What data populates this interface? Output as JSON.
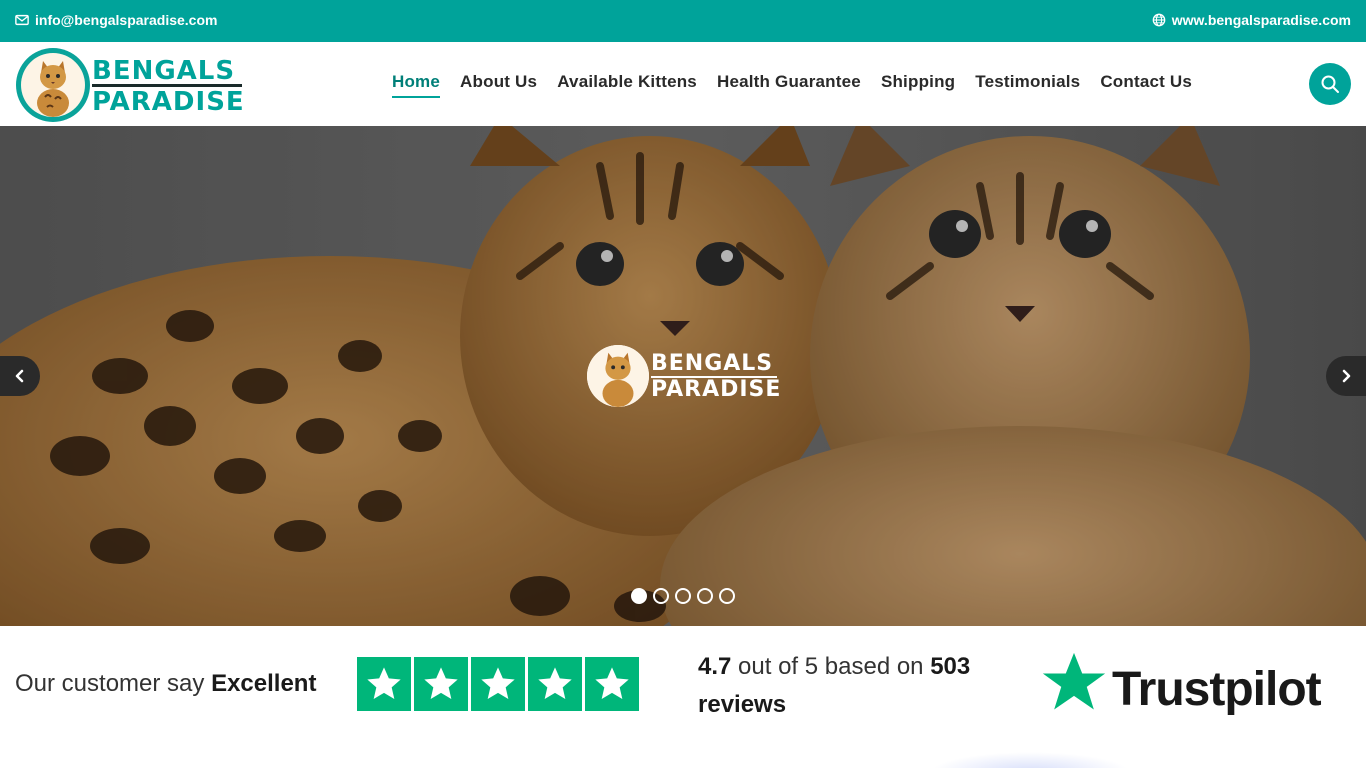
{
  "topbar": {
    "email": "info@bengalsparadise.com",
    "website": "www.bengalsparadise.com",
    "color": "#00a39a"
  },
  "logo": {
    "line1": "BENGALS",
    "line2": "PARADISE"
  },
  "nav": {
    "items": [
      {
        "label": "Home",
        "active": true
      },
      {
        "label": "About Us"
      },
      {
        "label": "Available Kittens"
      },
      {
        "label": "Health Guarantee"
      },
      {
        "label": "Shipping"
      },
      {
        "label": "Testimonials"
      },
      {
        "label": "Contact Us"
      }
    ]
  },
  "search": {
    "icon": "search-icon"
  },
  "hero": {
    "logo_line1": "BENGALS",
    "logo_line2": "PARADISE",
    "slides_total": 5,
    "active_slide": 1
  },
  "trust": {
    "say_prefix": "Our customer say",
    "say_word": "Excellent",
    "stars": 5,
    "score": "4.7",
    "out_of": "out of 5 based on",
    "count": "503",
    "reviews_word": "reviews",
    "brand": "Trustpilot",
    "star_color": "#00b67a"
  }
}
